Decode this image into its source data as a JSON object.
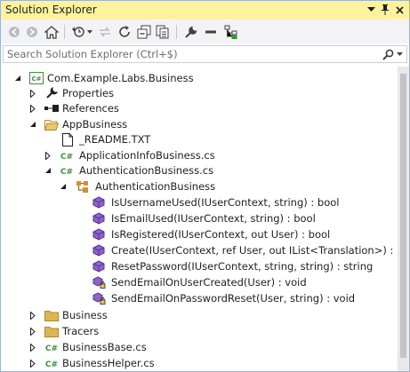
{
  "window": {
    "title": "Solution Explorer",
    "controls": [
      "dropdown-arrow-icon",
      "pin-icon",
      "close-icon"
    ]
  },
  "toolbar": {
    "buttons": [
      "back-icon",
      "forward-icon",
      "home-icon",
      "history-icon",
      "sync-icon",
      "refresh-icon",
      "collapse-all-icon",
      "show-all-files-icon",
      "properties-wrench-icon",
      "minus-icon",
      "preview-icon"
    ]
  },
  "search": {
    "placeholder": "Search Solution Explorer (Ctrl+$)"
  },
  "tree": {
    "project": "Com.Example.Labs.Business",
    "properties": "Properties",
    "references": "References",
    "appbusiness": "AppBusiness",
    "readme": "_README.TXT",
    "appinfo": "ApplicationInfoBusiness.cs",
    "authfile": "AuthenticationBusiness.cs",
    "authclass": "AuthenticationBusiness",
    "methods": [
      "IsUsernameUsed(IUserContext, string) : bool",
      "IsEmailUsed(IUserContext, string) : bool",
      "IsRegistered(IUserContext, out User) : bool",
      "Create(IUserContext, ref User, out IList<Translation>) : bool",
      "ResetPassword(IUserContext, string, string) : string",
      "SendEmailOnUserCreated(User) : void",
      "SendEmailOnPasswordReset(User, string) : void"
    ],
    "business": "Business",
    "tracers": "Tracers",
    "businessbase": "BusinessBase.cs",
    "businesshelper": "BusinessHelper.cs"
  },
  "colors": {
    "titlebar": "#fff29d",
    "csharp_badge": "#3e8f3e",
    "method_icon": "#6c3bb5",
    "folder": "#dcb455"
  }
}
